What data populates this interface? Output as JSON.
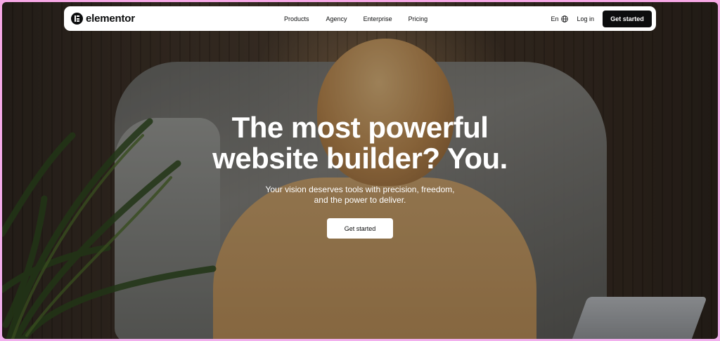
{
  "header": {
    "logo_text": "elementor",
    "nav": {
      "products": "Products",
      "agency": "Agency",
      "enterprise": "Enterprise",
      "pricing": "Pricing"
    },
    "language": "En",
    "login": "Log in",
    "cta": "Get started"
  },
  "hero": {
    "title_line1": "The most powerful",
    "title_line2": "website builder? You.",
    "subtitle_line1": "Your vision deserves tools with precision, freedom,",
    "subtitle_line2": "and the power to deliver.",
    "cta": "Get started"
  },
  "colors": {
    "page_border": "#f5aee8",
    "nav_bg": "#ffffff",
    "brand_dark": "#0c0d0e",
    "hero_text": "#ffffff"
  },
  "icons": {
    "logo": "elementor-logo-icon",
    "language": "globe-icon"
  }
}
